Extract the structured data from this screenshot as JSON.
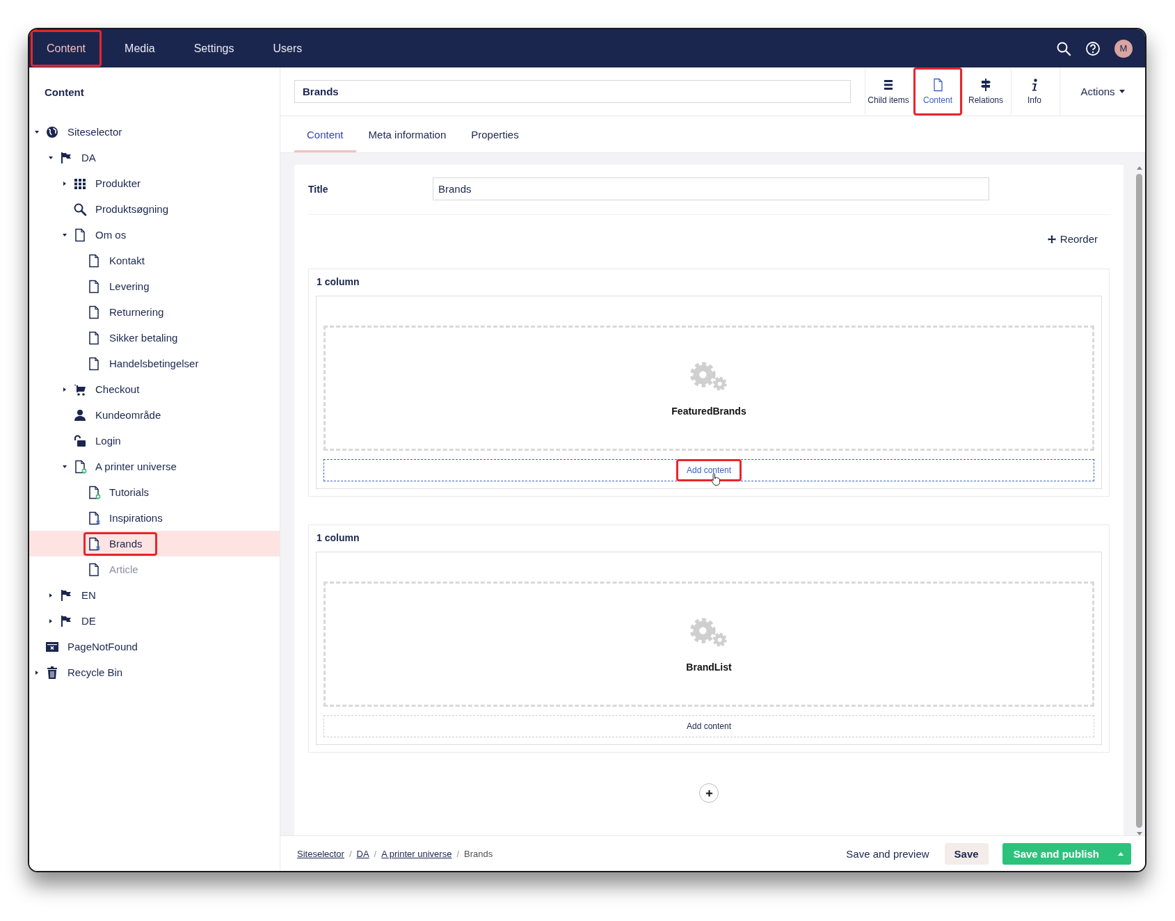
{
  "header": {
    "sections": [
      {
        "label": "Content",
        "selected": true,
        "highlighted": true
      },
      {
        "label": "Media",
        "selected": false,
        "highlighted": false
      },
      {
        "label": "Settings",
        "selected": false,
        "highlighted": false
      },
      {
        "label": "Users",
        "selected": false,
        "highlighted": false
      }
    ],
    "avatar": "M"
  },
  "sidebar": {
    "title": "Content",
    "tree": [
      {
        "label": "Siteselector",
        "kind": "globe",
        "expanded": true,
        "selected": false,
        "highlighted": false,
        "published": true,
        "children": [
          {
            "label": "DA",
            "kind": "flag",
            "expanded": true,
            "selected": false,
            "highlighted": false,
            "published": true,
            "children": [
              {
                "label": "Produkter",
                "kind": "grid",
                "expanded": false,
                "selected": false,
                "highlighted": false,
                "published": true
              },
              {
                "label": "Produktsøgning",
                "kind": "search",
                "selected": false,
                "highlighted": false,
                "published": true
              },
              {
                "label": "Om os",
                "kind": "page",
                "expanded": true,
                "selected": false,
                "highlighted": false,
                "published": true,
                "children": [
                  {
                    "label": "Kontakt",
                    "kind": "page",
                    "selected": false,
                    "highlighted": false,
                    "published": true
                  },
                  {
                    "label": "Levering",
                    "kind": "page",
                    "selected": false,
                    "highlighted": false,
                    "published": true
                  },
                  {
                    "label": "Returnering",
                    "kind": "page",
                    "selected": false,
                    "highlighted": false,
                    "published": true
                  },
                  {
                    "label": "Sikker betaling",
                    "kind": "page",
                    "selected": false,
                    "highlighted": false,
                    "published": true
                  },
                  {
                    "label": "Handelsbetingelser",
                    "kind": "page",
                    "selected": false,
                    "highlighted": false,
                    "published": true
                  }
                ]
              },
              {
                "label": "Checkout",
                "kind": "cart",
                "expanded": false,
                "selected": false,
                "highlighted": false,
                "published": true
              },
              {
                "label": "Kundeområde",
                "kind": "user",
                "selected": false,
                "highlighted": false,
                "published": true
              },
              {
                "label": "Login",
                "kind": "unlock",
                "selected": false,
                "highlighted": false,
                "published": true
              },
              {
                "label": "A printer universe",
                "kind": "page-plus",
                "expanded": true,
                "selected": false,
                "highlighted": false,
                "published": true,
                "children": [
                  {
                    "label": "Tutorials",
                    "kind": "page-plus",
                    "selected": false,
                    "highlighted": false,
                    "published": true
                  },
                  {
                    "label": "Inspirations",
                    "kind": "page-grid",
                    "selected": false,
                    "highlighted": false,
                    "published": true
                  },
                  {
                    "label": "Brands",
                    "kind": "page-grid",
                    "selected": true,
                    "highlighted": true,
                    "published": true
                  },
                  {
                    "label": "Article",
                    "kind": "page",
                    "selected": false,
                    "highlighted": false,
                    "published": false
                  }
                ]
              }
            ]
          },
          {
            "label": "EN",
            "kind": "flag",
            "expanded": false,
            "selected": false,
            "highlighted": false,
            "published": true
          },
          {
            "label": "DE",
            "kind": "flag",
            "expanded": false,
            "selected": false,
            "highlighted": false,
            "published": true
          }
        ]
      },
      {
        "label": "PageNotFound",
        "kind": "error-page",
        "selected": false,
        "highlighted": false,
        "published": true
      },
      {
        "label": "Recycle Bin",
        "kind": "bin",
        "expanded": false,
        "selected": false,
        "highlighted": false,
        "published": true
      }
    ]
  },
  "editor": {
    "name": "Brands",
    "apps": [
      {
        "label": "Child items",
        "kind": "list",
        "selected": false,
        "highlighted": false
      },
      {
        "label": "Content",
        "kind": "page",
        "selected": true,
        "highlighted": true
      },
      {
        "label": "Relations",
        "kind": "signpost",
        "selected": false,
        "highlighted": false
      },
      {
        "label": "Info",
        "kind": "info",
        "selected": false,
        "highlighted": false
      }
    ],
    "actions": "Actions",
    "tabs": [
      {
        "label": "Content",
        "selected": true
      },
      {
        "label": "Meta information",
        "selected": false
      },
      {
        "label": "Properties",
        "selected": false
      }
    ],
    "title_field": {
      "label": "Title",
      "value": "Brands"
    },
    "reorder": "Reorder",
    "sections": [
      {
        "heading": "1 column",
        "block": "FeaturedBrands",
        "add_button": {
          "label": "Add content",
          "hovered": true,
          "highlighted": true
        }
      },
      {
        "heading": "1 column",
        "block": "BrandList",
        "add_button": {
          "label": "Add content",
          "hovered": false,
          "highlighted": false
        }
      }
    ]
  },
  "footer": {
    "breadcrumb": [
      {
        "label": "Siteselector",
        "link": true
      },
      {
        "label": "DA",
        "link": true
      },
      {
        "label": "A printer universe",
        "link": true
      },
      {
        "label": "Brands",
        "link": false
      }
    ],
    "separator": "/",
    "buttons": {
      "preview": "Save and preview",
      "save": "Save",
      "publish": "Save and publish"
    }
  }
}
